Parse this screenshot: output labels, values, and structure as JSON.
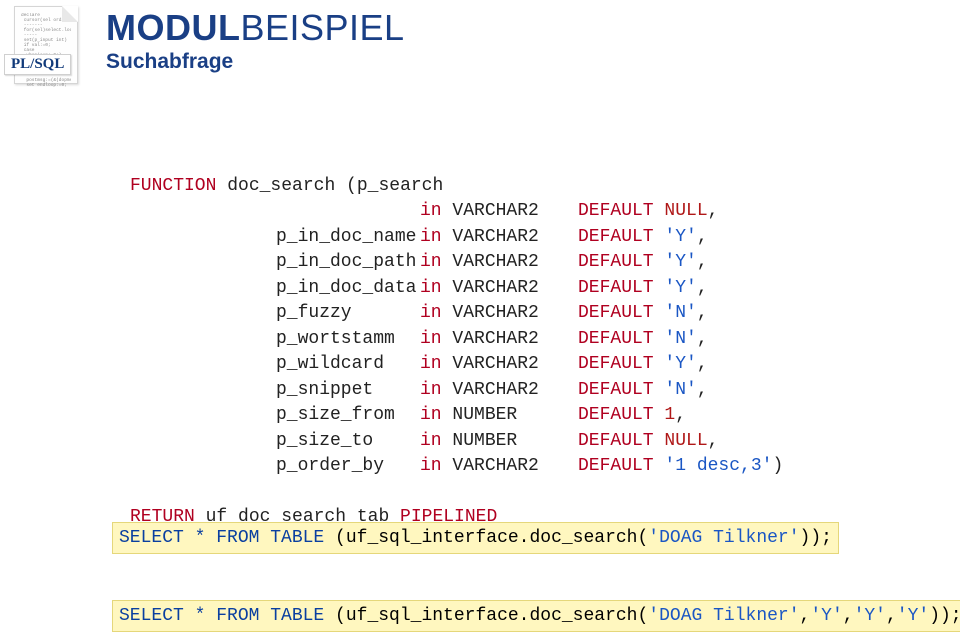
{
  "badge": "PL/SQL",
  "title_bold": "MODUL",
  "title_light": "BEISPIEL",
  "subtitle": "Suchabfrage",
  "func_header": {
    "kw_function": "FUNCTION",
    "name": " doc_search (",
    "first_param": "p_search"
  },
  "params": [
    {
      "name": "",
      "type_kw": "in",
      "type": " VARCHAR2",
      "def_kw": "DEFAULT",
      "val": " NULL",
      "val_cls": "num-red",
      "tail": ","
    },
    {
      "name": "p_in_doc_name",
      "type_kw": "in",
      "type": " VARCHAR2",
      "def_kw": "DEFAULT",
      "val": " 'Y'",
      "val_cls": "str-blue",
      "tail": ","
    },
    {
      "name": "p_in_doc_path",
      "type_kw": "in",
      "type": " VARCHAR2",
      "def_kw": "DEFAULT",
      "val": " 'Y'",
      "val_cls": "str-blue",
      "tail": ","
    },
    {
      "name": "p_in_doc_data",
      "type_kw": "in",
      "type": " VARCHAR2",
      "def_kw": "DEFAULT",
      "val": " 'Y'",
      "val_cls": "str-blue",
      "tail": ","
    },
    {
      "name": "p_fuzzy",
      "type_kw": "in",
      "type": " VARCHAR2",
      "def_kw": "DEFAULT",
      "val": " 'N'",
      "val_cls": "str-blue",
      "tail": ","
    },
    {
      "name": "p_wortstamm",
      "type_kw": "in",
      "type": " VARCHAR2",
      "def_kw": "DEFAULT",
      "val": " 'N'",
      "val_cls": "str-blue",
      "tail": ","
    },
    {
      "name": "p_wildcard",
      "type_kw": "in",
      "type": " VARCHAR2",
      "def_kw": "DEFAULT",
      "val": " 'Y'",
      "val_cls": "str-blue",
      "tail": ","
    },
    {
      "name": "p_snippet",
      "type_kw": "in",
      "type": " VARCHAR2",
      "def_kw": "DEFAULT",
      "val": " 'N'",
      "val_cls": "str-blue",
      "tail": ","
    },
    {
      "name": "p_size_from",
      "type_kw": "in",
      "type": " NUMBER",
      "def_kw": "DEFAULT",
      "val": " 1",
      "val_cls": "num-red",
      "tail": ","
    },
    {
      "name": "p_size_to",
      "type_kw": "in",
      "type": " NUMBER",
      "def_kw": "DEFAULT",
      "val": " NULL",
      "val_cls": "num-red",
      "tail": ","
    },
    {
      "name": "p_order_by",
      "type_kw": "in",
      "type": " VARCHAR2",
      "def_kw": "DEFAULT",
      "val": " '1 desc,3'",
      "val_cls": "str-blue",
      "tail": ")"
    }
  ],
  "return_line": {
    "kw_return": "RETURN",
    "mid": " uf_doc_search_tab ",
    "kw_pipelined": "PIPELINED"
  },
  "select1": {
    "pre": "SELECT * FROM TABLE",
    "mid": " (uf_sql_interface.doc_search(",
    "arg": "'DOAG Tilkner'",
    "post": "));"
  },
  "select2": {
    "pre": "SELECT * FROM TABLE",
    "mid": " (uf_sql_interface.doc_search(",
    "arg": "'DOAG Tilkner'",
    "c": ",",
    "y": "'Y'",
    "post": "));"
  }
}
